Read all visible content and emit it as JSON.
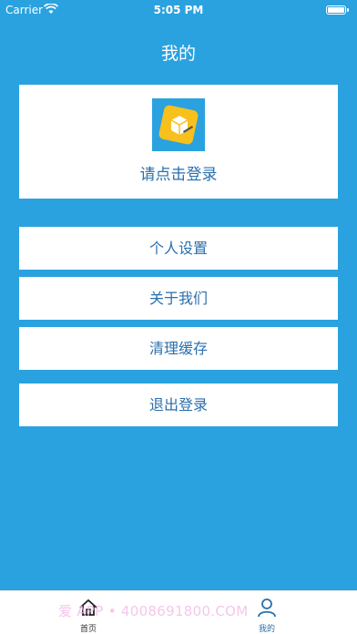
{
  "status_bar": {
    "carrier": "Carrier",
    "time": "5:05 PM"
  },
  "header": {
    "title": "我的"
  },
  "profile": {
    "login_label": "请点击登录"
  },
  "menu": {
    "items": [
      {
        "label": "个人设置"
      },
      {
        "label": "关于我们"
      },
      {
        "label": "清理缓存"
      },
      {
        "label": "退出登录"
      }
    ]
  },
  "tab_bar": {
    "home_label": "首页",
    "mine_label": "我的"
  },
  "watermark": {
    "text": "爱    APP • 4008691800.COM"
  },
  "colors": {
    "background": "#2aa2df",
    "accent_text": "#2a6fae",
    "card": "#ffffff"
  }
}
